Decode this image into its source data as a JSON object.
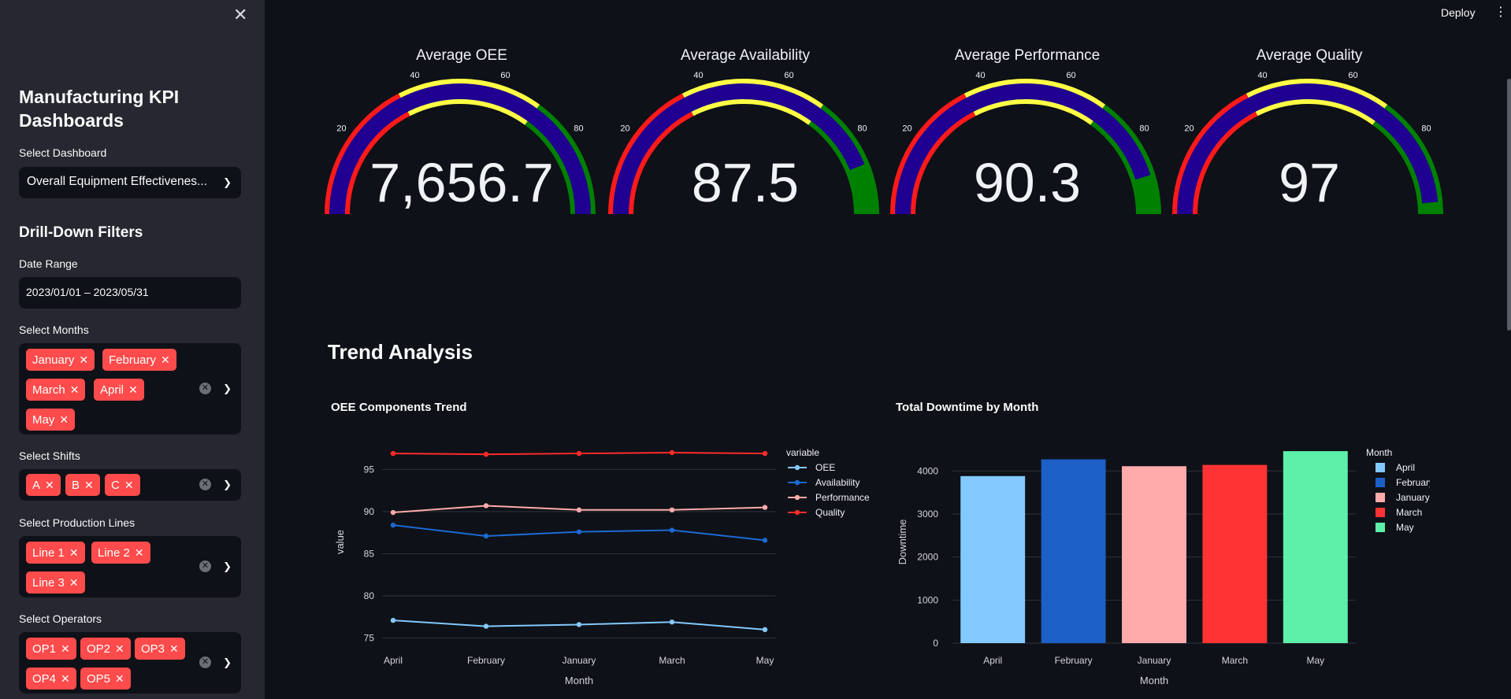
{
  "sidebar": {
    "title": "Manufacturing KPI Dashboards",
    "dashboard_label": "Select Dashboard",
    "dashboard_value": "Overall Equipment Effectivenes...",
    "drill_title": "Drill-Down Filters",
    "date_label": "Date Range",
    "date_value": "2023/01/01 – 2023/05/31",
    "months_label": "Select Months",
    "months": [
      "January",
      "February",
      "March",
      "April",
      "May"
    ],
    "shifts_label": "Select Shifts",
    "shifts": [
      "A",
      "B",
      "C"
    ],
    "lines_label": "Select Production Lines",
    "lines": [
      "Line 1",
      "Line 2",
      "Line 3"
    ],
    "operators_label": "Select Operators",
    "operators": [
      "OP1",
      "OP2",
      "OP3",
      "OP4",
      "OP5"
    ]
  },
  "header": {
    "deploy": "Deploy"
  },
  "gauges": [
    {
      "title": "Average OEE",
      "display": "7,656.7",
      "value": 7656.7,
      "ticks": [
        "20",
        "40",
        "60",
        "80"
      ]
    },
    {
      "title": "Average Availability",
      "display": "87.5",
      "value": 87.5,
      "ticks": [
        "20",
        "40",
        "60",
        "80"
      ]
    },
    {
      "title": "Average Performance",
      "display": "90.3",
      "value": 90.3,
      "ticks": [
        "20",
        "40",
        "60",
        "80"
      ]
    },
    {
      "title": "Average Quality",
      "display": "97",
      "value": 97,
      "ticks": [
        "20",
        "40",
        "60",
        "80"
      ]
    }
  ],
  "gauge_colors": {
    "low": "#ff1a1a",
    "mid": "#ffff44",
    "high": "#008000",
    "bar": "#1f0090"
  },
  "trend_title": "Trend Analysis",
  "chart_data": [
    {
      "type": "line",
      "title": "OEE Components Trend",
      "xlabel": "Month",
      "ylabel": "value",
      "categories": [
        "April",
        "February",
        "January",
        "March",
        "May"
      ],
      "ylim": [
        74.4,
        98.4
      ],
      "yticks": [
        75,
        80,
        85,
        90,
        95
      ],
      "legend_title": "variable",
      "series": [
        {
          "name": "OEE",
          "color": "#83c9ff",
          "values": [
            77.1,
            76.4,
            76.6,
            76.9,
            76.0
          ]
        },
        {
          "name": "Availability",
          "color": "#1c6ad2",
          "values": [
            88.4,
            87.1,
            87.6,
            87.8,
            86.6
          ]
        },
        {
          "name": "Performance",
          "color": "#ffabab",
          "values": [
            89.9,
            90.7,
            90.2,
            90.2,
            90.5
          ]
        },
        {
          "name": "Quality",
          "color": "#ff2b2b",
          "values": [
            96.9,
            96.8,
            96.9,
            97.0,
            96.9
          ]
        }
      ]
    },
    {
      "type": "bar",
      "title": "Total Downtime by Month",
      "xlabel": "Month",
      "ylabel": "Downtime",
      "legend_title": "Month",
      "categories": [
        "April",
        "February",
        "January",
        "March",
        "May"
      ],
      "values": [
        3880,
        4270,
        4110,
        4140,
        4460
      ],
      "colors": [
        "#83c9ff",
        "#1c5fc7",
        "#ffabab",
        "#ff3333",
        "#5cf0a8"
      ],
      "ylim": [
        0,
        4700
      ],
      "yticks": [
        0,
        1000,
        2000,
        3000,
        4000
      ]
    }
  ]
}
